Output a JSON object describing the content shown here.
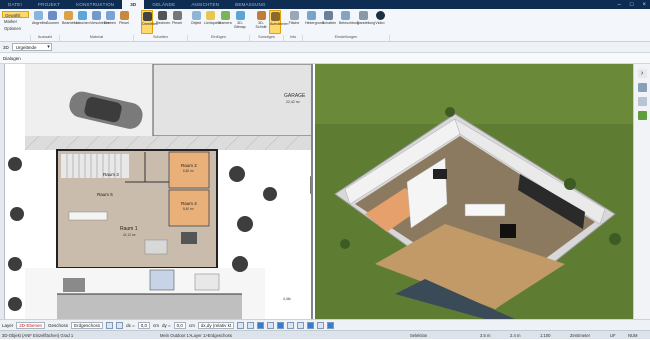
{
  "tabs": [
    "DATEI",
    "PROJEKT",
    "KONSTRUKTION",
    "3D",
    "GELÄNDE",
    "ANSICHTEN",
    "BEMASSUNG"
  ],
  "active_tab_index": 3,
  "quick_access": [
    "Gewählt",
    "Marker",
    "Optionen"
  ],
  "ribbon_buttons": [
    {
      "label": "Abgreifen",
      "group": "Auswahl"
    },
    {
      "label": "Zoomen",
      "group": "Auswahl"
    },
    {
      "label": "Bearbeiten",
      "group": "Material"
    },
    {
      "label": "Löschen",
      "group": "Material"
    },
    {
      "label": "Verschieben",
      "group": "Material"
    },
    {
      "label": "Drehen",
      "group": "Material"
    },
    {
      "label": "Pinsel",
      "group": "Material"
    },
    {
      "label": "Darstellen",
      "group": "Schatten"
    },
    {
      "label": "Rechnen",
      "group": "Schatten"
    },
    {
      "label": "Pinsel",
      "group": "Schatten"
    },
    {
      "label": "Objekt",
      "group": "Einfügen"
    },
    {
      "label": "Lichtquelle",
      "group": "Einfügen"
    },
    {
      "label": "Kamera",
      "group": "Einfügen"
    },
    {
      "label": "3D-Bitmap",
      "group": "Einfügen"
    },
    {
      "label": "3D-Schnitt",
      "group": "Sonstiges"
    },
    {
      "label": "Aufnahmen",
      "group": "Sonstiges"
    },
    {
      "label": "Fläche",
      "group": "Info"
    },
    {
      "label": "Hintergrund",
      "group": "Einstellungen"
    },
    {
      "label": "Schatten",
      "group": "Einstellungen"
    },
    {
      "label": "Beleuchtung",
      "group": "Einstellungen"
    },
    {
      "label": "Darstellung",
      "group": "Einstellungen"
    },
    {
      "label": "Video",
      "group": "Einstellungen"
    }
  ],
  "ribbon_groups": [
    "Auswahl",
    "Material",
    "Schatten",
    "Einfügen",
    "Sonstiges",
    "Info",
    "Einstellungen"
  ],
  "view_selector": {
    "label": "3D",
    "value": "Urgelände"
  },
  "third_row_label": "Dialogen",
  "plan": {
    "garage_label": "GARAGE",
    "garage_area": "22,42 m²",
    "rooms": [
      {
        "name": "Raum 1",
        "area": "41,12 m²"
      },
      {
        "name": "Raum 2",
        "area": "6,60 m²"
      },
      {
        "name": "Raum 3",
        "area": "9,60 m²"
      },
      {
        "name": "Raum 4",
        "area": "8,40 m²"
      },
      {
        "name": "Raum 5"
      }
    ],
    "dimension": "4,46²"
  },
  "bottom_toolbar": {
    "layer_label": "Layer",
    "layer_value": "2D-Ebenen",
    "floor_label": "Geschoss",
    "floor_value": "Erdgeschoss",
    "dx_label": "dx =",
    "dx_value": "0,0",
    "dx_unit": "cm",
    "dy_label": "dy =",
    "dy_value": "0,0",
    "dy_unit": "cm",
    "dxdy_text": "dx,dy (relativ kt"
  },
  "status": {
    "left": "3D-Objekt (ANF Einzelflächen) Grad 1",
    "middle": "Mein Outdoor 1>Layer 1>Erdgeschoss",
    "mode": "Selektion",
    "coords_x": "3.5 m",
    "coords_y": "2.4 m",
    "scale": "1:100",
    "unit": "Zentimeter",
    "caps": "UF",
    "num": "NUM"
  },
  "colors": {
    "title_bar": "#0f2d52",
    "highlight": "#ffd86b",
    "accent": "#2f7fd6",
    "red_text": "#c0211f"
  }
}
